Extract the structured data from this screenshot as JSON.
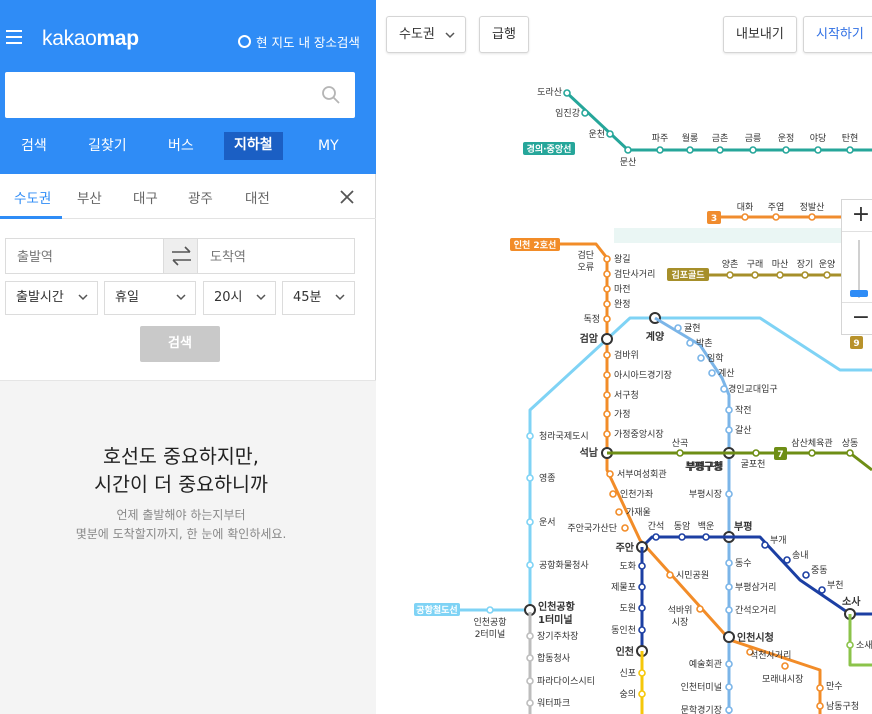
{
  "app": {
    "logo_light": "kakao",
    "logo_bold": "map",
    "local_search_label": "현 지도 내 장소검색"
  },
  "search": {
    "placeholder": "",
    "value": ""
  },
  "nav_tabs": [
    "검색",
    "길찾기",
    "버스",
    "지하철",
    "MY"
  ],
  "active_nav_tab": "지하철",
  "region_tabs": [
    "수도권",
    "부산",
    "대구",
    "광주",
    "대전"
  ],
  "active_region": "수도권",
  "route": {
    "departure_placeholder": "출발역",
    "arrival_placeholder": "도착역",
    "time_type": "출발시간",
    "day_type": "휴일",
    "hour": "20시",
    "minute": "45분",
    "search_label": "검색"
  },
  "info": {
    "title_line1": "호선도 중요하지만,",
    "title_line2": "시간이 더 중요하니까",
    "sub_line1": "언제 출발해야 하는지부터",
    "sub_line2": "몇분에 도착할지까지, 한 눈에 확인하세요."
  },
  "map_controls": {
    "region_select": "수도권",
    "express": "급행",
    "export": "내보내기",
    "start": "시작하기",
    "zoom_in": "+",
    "zoom_out": "−"
  },
  "colors": {
    "brand_blue": "#2f8cf6",
    "gyeongui": "#26a69a",
    "line3": "#f08c2e",
    "gimpo": "#a68f2a",
    "incheon2": "#f28c28",
    "airport": "#7fd3f5",
    "line7": "#6e8e15",
    "line1": "#1c3fa3",
    "incheon1": "#7bb5e8",
    "suin": "#f5c70a",
    "seohae": "#8bc34a"
  },
  "lines": {
    "gyeongui_label": "경의·중앙선",
    "line3_label": "3",
    "gimpo_label": "김포골드",
    "incheon2_label": "인천 2호선",
    "line7_label": "7",
    "line9_label": "9",
    "airport_label": "공항철도선"
  },
  "stations": {
    "gyeongui": [
      "도라산",
      "임진강",
      "운천",
      "문산",
      "파주",
      "월롱",
      "금촌",
      "금릉",
      "운정",
      "야당",
      "탄현"
    ],
    "line3": [
      "대화",
      "주엽",
      "정발산"
    ],
    "gimpo": [
      "양촌",
      "구래",
      "마산",
      "장기",
      "운양"
    ],
    "incheon2_top": [
      "검단오류",
      "왕길",
      "검단사거리",
      "마전",
      "완정",
      "독정"
    ],
    "incheon2_mid": [
      "검암",
      "검바위",
      "아시아드경기장",
      "서구청",
      "가정",
      "가정중앙시장",
      "석남",
      "서부여성회관",
      "인천가좌",
      "가재울",
      "주안국가산단",
      "주안"
    ],
    "incheon2_lower": [
      "시민공원",
      "석바위시장",
      "인천시청",
      "석천사거리",
      "모래내시장",
      "만수",
      "남동구청"
    ],
    "airport": [
      "계양",
      "청라국제도시",
      "영종",
      "운서",
      "공항화물청사",
      "인천공항1터미널",
      "인천공항2터미널"
    ],
    "maglev": [
      "장기주차장",
      "합동청사",
      "파라다이스시티",
      "워터파크"
    ],
    "incheon1": [
      "귤현",
      "박촌",
      "임학",
      "계산",
      "경인교대입구",
      "작전",
      "갈산",
      "부평구청",
      "부평시장",
      "부평",
      "동수",
      "부평삼거리",
      "간석오거리",
      "인천시청",
      "예술회관",
      "인천터미널",
      "문학경기장"
    ],
    "line7": [
      "산곡",
      "부평구청",
      "굴포천",
      "삼산체육관",
      "상동"
    ],
    "line1": [
      "주안",
      "간석",
      "동암",
      "백운",
      "부평",
      "부개",
      "송내",
      "중동",
      "부천",
      "소사"
    ],
    "suin": [
      "도화",
      "제물포",
      "도원",
      "동인천",
      "인천",
      "신포",
      "숭의"
    ],
    "seohae": [
      "소새울"
    ]
  }
}
